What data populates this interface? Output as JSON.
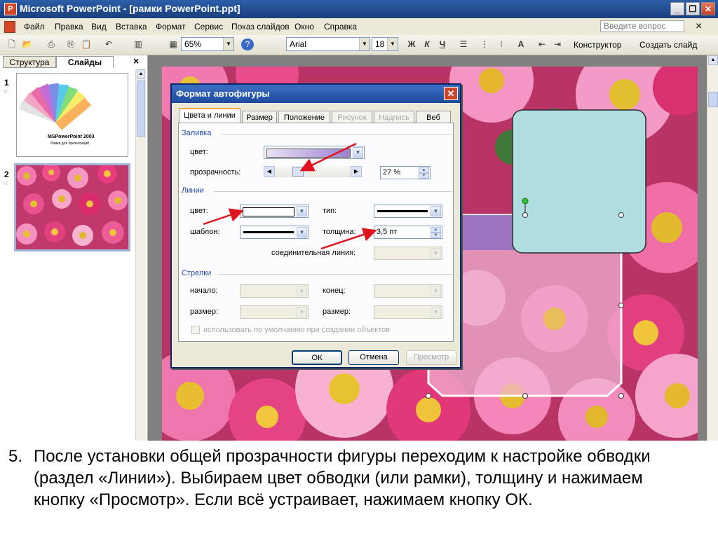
{
  "window": {
    "title": "Microsoft PowerPoint - [рамки PowerPoint.ppt]",
    "app_icon": "P",
    "buttons": [
      "_",
      "❐",
      "✕"
    ]
  },
  "menu": {
    "items": [
      "Файл",
      "Правка",
      "Вид",
      "Вставка",
      "Формат",
      "Сервис",
      "Показ слайдов",
      "Окно",
      "Справка"
    ],
    "ask_placeholder": "Введите вопрос",
    "close": "×"
  },
  "toolbar": {
    "zoom": "65%",
    "font": "Arial",
    "font_size": "18",
    "bold": "Ж",
    "italic": "К",
    "underline": "Ч",
    "designer": "Конструктор",
    "new_slide": "Создать слайд"
  },
  "left_pane": {
    "tabs": [
      "Структура",
      "Слайды"
    ],
    "close": "×",
    "slides": [
      {
        "number": "1",
        "title": "MSPowerPoint 2003",
        "subtitle": "Рамки для презентаций"
      },
      {
        "number": "2"
      }
    ]
  },
  "dialog": {
    "title": "Формат автофигуры",
    "close": "✕",
    "tabs": [
      "Цвета и линии",
      "Размер",
      "Положение",
      "Рисунок",
      "Надпись",
      "Веб"
    ],
    "fill": {
      "heading": "Заливка",
      "color_label": "цвет:",
      "transparency_label": "прозрачность:",
      "transparency_value": "27 %",
      "transparency_fraction": 0.27,
      "fill_color": "#c9b6e4"
    },
    "lines": {
      "heading": "Линии",
      "color_label": "цвет:",
      "type_label": "тип:",
      "pattern_label": "шаблон:",
      "weight_label": "толщина:",
      "weight_value": "3,5 пт",
      "connector_label": "соединительная линия:"
    },
    "arrows": {
      "heading": "Стрелки",
      "begin_label": "начало:",
      "end_label": "конец:",
      "size_label": "размер:",
      "size_label2": "размер:"
    },
    "default_checkbox": "использовать по умолчанию при создании объектов",
    "buttons": {
      "ok": "ОК",
      "cancel": "Отмена",
      "preview": "Просмотр"
    }
  },
  "caption": {
    "number": "5.",
    "lines": [
      "После установки общей прозрачности фигуры переходим к настройке обводки",
      "(раздел «Линии»). Выбираем цвет обводки (или рамки), толщину и нажимаем",
      "кнопку «Просмотр». Если всё устраивает, нажимаем кнопку ОК."
    ]
  },
  "colors": {
    "title_bar": "#1a3f7d",
    "dialog_accent": "#f1a63a",
    "arrow_red": "#e0141e",
    "shape_teal": "#b0dde0",
    "shape_purple": "#8d6cc0"
  }
}
